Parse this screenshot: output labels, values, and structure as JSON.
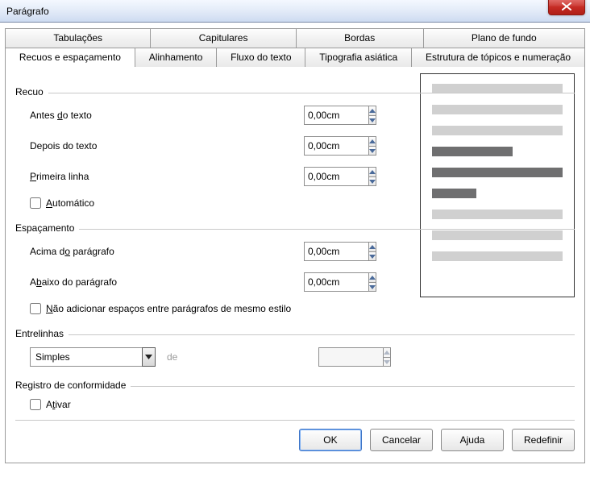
{
  "window": {
    "title": "Parágrafo"
  },
  "tabs_row1": [
    {
      "label": "Tabulações"
    },
    {
      "label": "Capitulares"
    },
    {
      "label": "Bordas"
    },
    {
      "label": "Plano de fundo"
    }
  ],
  "tabs_row2": [
    {
      "label": "Recuos e espaçamento"
    },
    {
      "label": "Alinhamento"
    },
    {
      "label": "Fluxo do texto"
    },
    {
      "label": "Tipografia asiática"
    },
    {
      "label": "Estrutura de tópicos e numeração"
    }
  ],
  "groups": {
    "recuo": {
      "legend": "Recuo",
      "antes_label_pre": "Antes ",
      "antes_label_ul": "d",
      "antes_label_post": "o texto",
      "antes_value": "0,00cm",
      "depois_label": "Depois do texto",
      "depois_value": "0,00cm",
      "primeira_label_ul": "P",
      "primeira_label_post": "rimeira linha",
      "primeira_value": "0,00cm",
      "auto_label_ul": "A",
      "auto_label_post": "utomático"
    },
    "espacamento": {
      "legend": "Espaçamento",
      "acima_label_pre": "Acima d",
      "acima_label_ul": "o",
      "acima_label_post": " parágrafo",
      "acima_value": "0,00cm",
      "abaixo_label_pre": "A",
      "abaixo_label_ul": "b",
      "abaixo_label_post": "aixo do parágrafo",
      "abaixo_value": "0,00cm",
      "nao_label_ul": "N",
      "nao_label_post": "ão adicionar espaços entre parágrafos de mesmo estilo"
    },
    "entrelinhas": {
      "legend": "Entrelinhas",
      "combo_value": "Simples",
      "de_label": "de",
      "spin_value": ""
    },
    "registro": {
      "legend": "Registro de conformidade",
      "ativar_label_pre": "A",
      "ativar_label_ul": "t",
      "ativar_label_post": "ivar"
    }
  },
  "buttons": {
    "ok": "OK",
    "cancel": "Cancelar",
    "help": "Ajuda",
    "reset": "Redefinir"
  }
}
